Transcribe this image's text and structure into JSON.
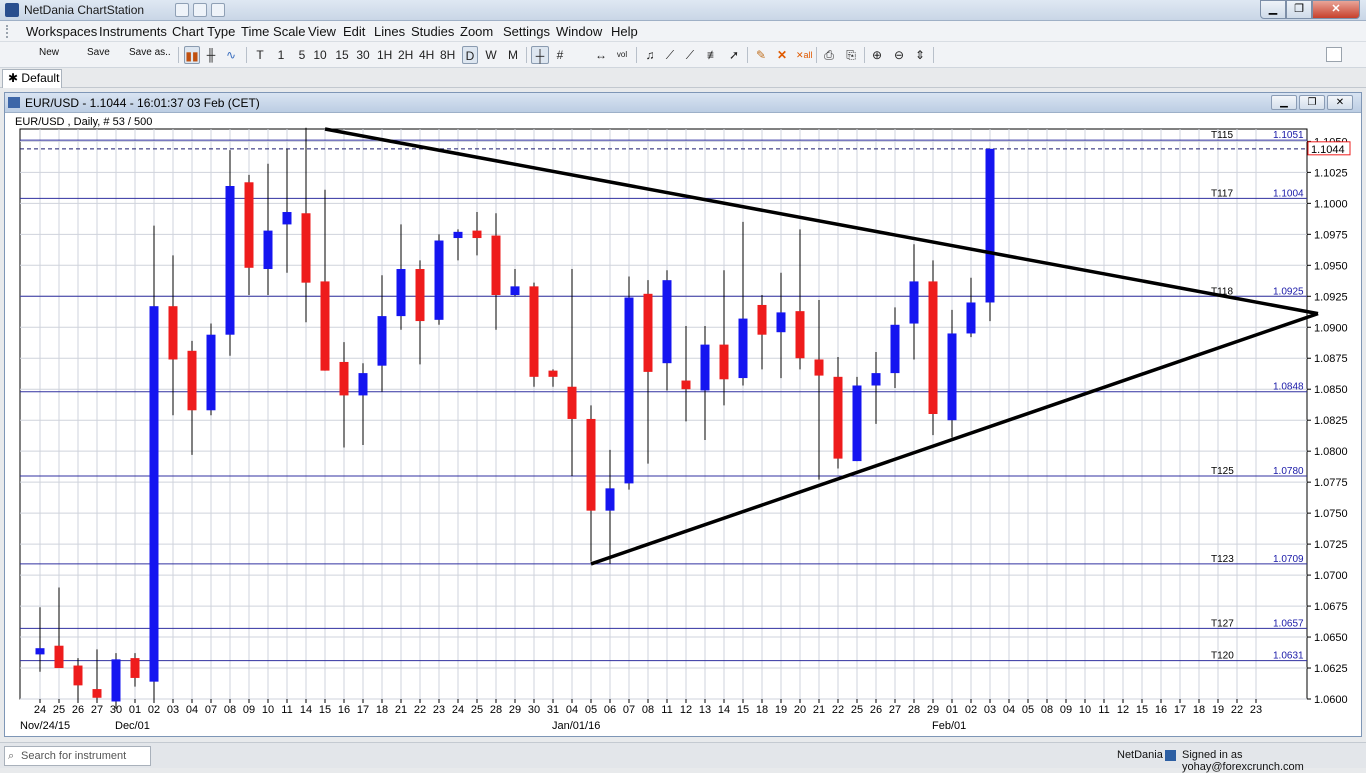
{
  "window": {
    "title": "NetDania ChartStation",
    "min_label": "▁",
    "max_label": "❐",
    "close_label": "✕"
  },
  "menu": [
    "Workspaces",
    "Instruments",
    "Chart Type",
    "Time Scale",
    "View",
    "Edit",
    "Lines",
    "Studies",
    "Zoom",
    "Settings",
    "Window",
    "Help"
  ],
  "toolbar": {
    "new_label": "New",
    "save_label": "Save",
    "save_as_label": "Save as..",
    "timeframes": [
      "T",
      "1",
      "5",
      "10",
      "15",
      "30",
      "1H",
      "2H",
      "4H",
      "8H",
      "D",
      "W",
      "M"
    ],
    "active_timeframe": "D"
  },
  "tabs": [
    {
      "label": "Default",
      "icon": "pin-icon"
    }
  ],
  "chart_window": {
    "title": "EUR/USD - 1.1044 - 16:01:37  03 Feb (CET)",
    "subtitle": "EUR/USD , Daily, # 53 / 500"
  },
  "chart_data": {
    "type": "candlestick",
    "symbol": "EUR/USD",
    "last_price": "1.1044",
    "ylim": [
      1.06,
      1.106
    ],
    "y_ticks": [
      "1.0600",
      "1.0625",
      "1.0650",
      "1.0675",
      "1.0700",
      "1.0725",
      "1.0750",
      "1.0775",
      "1.0800",
      "1.0825",
      "1.0850",
      "1.0875",
      "1.0900",
      "1.0925",
      "1.0950",
      "1.0975",
      "1.1000",
      "1.1025",
      "1.1050"
    ],
    "x_ticks": [
      "24",
      "25",
      "26",
      "27",
      "30",
      "01",
      "02",
      "03",
      "04",
      "07",
      "08",
      "09",
      "10",
      "11",
      "14",
      "15",
      "16",
      "17",
      "18",
      "21",
      "22",
      "23",
      "24",
      "25",
      "28",
      "29",
      "30",
      "31",
      "04",
      "05",
      "06",
      "07",
      "08",
      "11",
      "12",
      "13",
      "14",
      "15",
      "18",
      "19",
      "20",
      "21",
      "22",
      "25",
      "26",
      "27",
      "28",
      "29",
      "01",
      "02",
      "03",
      "04",
      "05",
      "08",
      "09",
      "10",
      "11",
      "12",
      "15",
      "16",
      "17",
      "18",
      "19",
      "22",
      "23"
    ],
    "date_labels": [
      {
        "label": "Nov/24/15",
        "index": 0
      },
      {
        "label": "Dec/01",
        "index": 5
      },
      {
        "label": "Jan/01/16",
        "index": 28
      },
      {
        "label": "Feb/01",
        "index": 48
      }
    ],
    "candles": [
      [
        1.0636,
        1.0674,
        1.0622,
        1.0641
      ],
      [
        1.0643,
        1.069,
        1.0628,
        1.0625
      ],
      [
        1.0627,
        1.0633,
        1.06,
        1.0611
      ],
      [
        1.0608,
        1.064,
        1.0597,
        1.0601
      ],
      [
        1.0598,
        1.0637,
        1.0592,
        1.0632
      ],
      [
        1.0633,
        1.0637,
        1.061,
        1.0617
      ],
      [
        1.0614,
        1.0982,
        1.06,
        1.0917
      ],
      [
        1.0917,
        1.0958,
        1.0829,
        1.0874
      ],
      [
        1.0881,
        1.0889,
        1.0797,
        1.0833
      ],
      [
        1.0833,
        1.0903,
        1.0829,
        1.0894
      ],
      [
        1.0894,
        1.1043,
        1.0877,
        1.1014
      ],
      [
        1.1017,
        1.1023,
        1.0926,
        1.0948
      ],
      [
        1.0947,
        1.1032,
        1.0926,
        1.0978
      ],
      [
        1.0983,
        1.1044,
        1.0944,
        1.0993
      ],
      [
        1.0992,
        1.1061,
        1.0904,
        1.0936
      ],
      [
        1.0937,
        1.1011,
        1.0865,
        1.0865
      ],
      [
        1.0872,
        1.0888,
        1.0803,
        1.0845
      ],
      [
        1.0845,
        1.0871,
        1.0805,
        1.0863
      ],
      [
        1.0869,
        1.0942,
        1.0848,
        1.0909
      ],
      [
        1.0909,
        1.0983,
        1.0898,
        1.0947
      ],
      [
        1.0947,
        1.0954,
        1.087,
        1.0905
      ],
      [
        1.0906,
        1.0975,
        1.0902,
        1.097
      ],
      [
        1.0972,
        1.0979,
        1.0954,
        1.0977
      ],
      [
        1.0978,
        1.0993,
        1.0958,
        1.0972
      ],
      [
        1.0974,
        1.0992,
        1.0898,
        1.0926
      ],
      [
        1.0926,
        1.0947,
        1.0925,
        1.0933
      ],
      [
        1.0933,
        1.0936,
        1.0852,
        1.086
      ],
      [
        1.0865,
        1.0866,
        1.0852,
        1.086
      ],
      [
        1.0852,
        1.0947,
        1.078,
        1.0826
      ],
      [
        1.0826,
        1.0837,
        1.0711,
        1.0752
      ],
      [
        1.0752,
        1.0801,
        1.0709,
        1.077
      ],
      [
        1.0774,
        1.0941,
        1.0769,
        1.0924
      ],
      [
        1.0927,
        1.0938,
        1.079,
        1.0864
      ],
      [
        1.0871,
        1.0946,
        1.0849,
        1.0938
      ],
      [
        1.0857,
        1.0901,
        1.0824,
        1.085
      ],
      [
        1.0849,
        1.0901,
        1.0809,
        1.0886
      ],
      [
        1.0886,
        1.0946,
        1.0837,
        1.0858
      ],
      [
        1.0859,
        1.0985,
        1.0853,
        1.0907
      ],
      [
        1.0918,
        1.0926,
        1.0866,
        1.0894
      ],
      [
        1.0896,
        1.0944,
        1.0859,
        1.0912
      ],
      [
        1.0913,
        1.0979,
        1.0866,
        1.0875
      ],
      [
        1.0874,
        1.0922,
        1.0777,
        1.0861
      ],
      [
        1.086,
        1.0876,
        1.0786,
        1.0794
      ],
      [
        1.0792,
        1.086,
        1.0792,
        1.0853
      ],
      [
        1.0853,
        1.088,
        1.0822,
        1.0863
      ],
      [
        1.0863,
        1.0916,
        1.0851,
        1.0902
      ],
      [
        1.0903,
        1.0967,
        1.0874,
        1.0937
      ],
      [
        1.0937,
        1.0954,
        1.0813,
        1.083
      ],
      [
        1.0825,
        1.0914,
        1.0811,
        1.0895
      ],
      [
        1.0895,
        1.094,
        1.0892,
        1.092
      ],
      [
        1.092,
        1.1044,
        1.0905,
        1.1044
      ]
    ],
    "levels": [
      {
        "label": "T115",
        "value": "1.1051"
      },
      {
        "label": "T117",
        "value": "1.1004"
      },
      {
        "label": "T118",
        "value": "1.0925"
      },
      {
        "label": "",
        "value": "1.0848"
      },
      {
        "label": "T125",
        "value": "1.0780"
      },
      {
        "label": "T123",
        "value": "1.0709"
      },
      {
        "label": "T127",
        "value": "1.0657"
      },
      {
        "label": "T120",
        "value": "1.0631"
      }
    ],
    "trendlines": [
      {
        "name": "resistance",
        "from": [
          15,
          1.106
        ],
        "to": [
          68,
          1.0911
        ]
      },
      {
        "name": "support",
        "from": [
          29,
          1.0709
        ],
        "to": [
          68,
          1.0911
        ]
      }
    ],
    "colors": {
      "bull": "#1515f0",
      "bear": "#ee1c1c",
      "grid": "#cfd3dc",
      "level": "#3030a0",
      "trend": "#000000",
      "last_price_box": "#ee1c1c"
    }
  },
  "status": {
    "search_placeholder": "Search for instrument",
    "brand": "NetDania",
    "signed_in": "Signed in as yohay@forexcrunch.com"
  }
}
